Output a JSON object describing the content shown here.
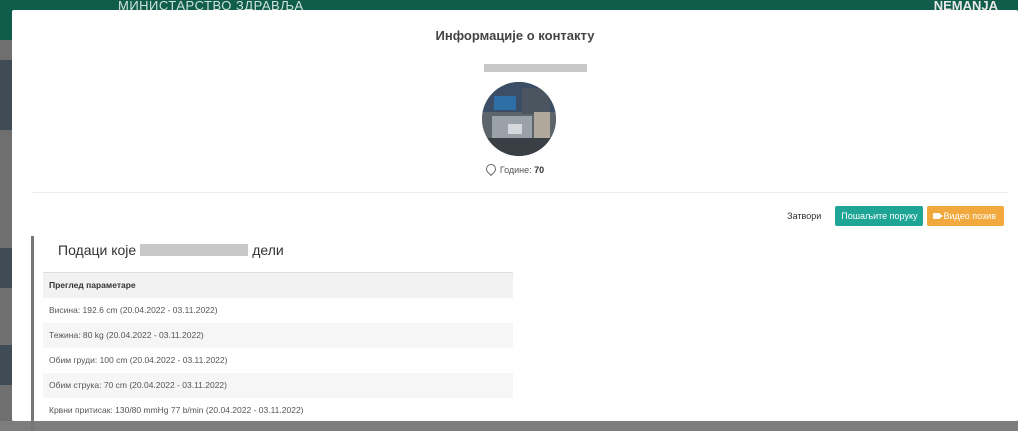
{
  "background": {
    "ministry": "МИНИСТАРСТВО ЗДРАВЉА",
    "user": "NEMANJA"
  },
  "modal": {
    "title": "Информације о контакту",
    "age_label": "Године:",
    "age_value": "70",
    "buttons": {
      "close": "Затвори",
      "message": "Пошаљите поруку",
      "video": "Видео позив"
    },
    "shared": {
      "heading_prefix": "Подаци које",
      "heading_suffix": "дели",
      "table_header": "Преглед параметаре",
      "rows": [
        "Висина: 192.6 cm (20.04.2022 - 03.11.2022)",
        "Тежина: 80 kg (20.04.2022 - 03.11.2022)",
        "Обим груди: 100 cm (20.04.2022 - 03.11.2022)",
        "Обим струка: 70 cm (20.04.2022 - 03.11.2022)",
        "Крвни притисак: 130/80 mmHg 77 b/min (20.04.2022 - 03.11.2022)"
      ]
    }
  },
  "colors": {
    "message_button": "#1fa595",
    "video_button": "#f1a93e",
    "header_bg": "#0f5d4a"
  },
  "icons": {
    "age": "location-pin-icon",
    "video": "video-camera-icon"
  }
}
